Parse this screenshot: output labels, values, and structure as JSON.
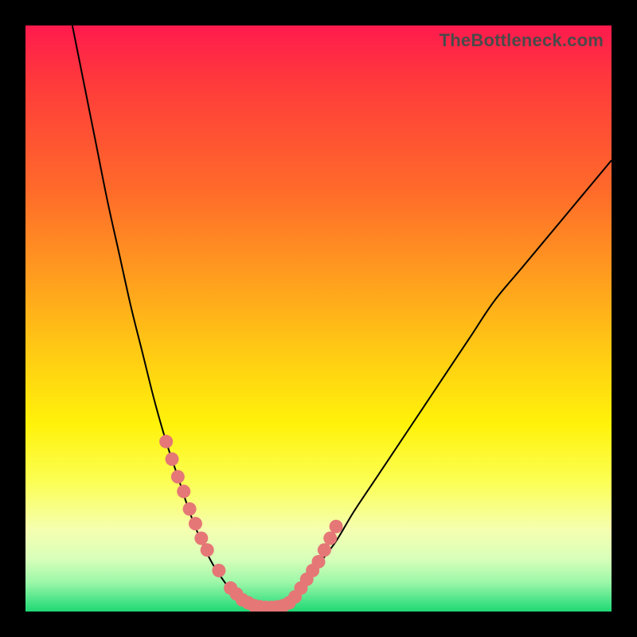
{
  "watermark": {
    "text": "TheBottleneck.com"
  },
  "chart_data": {
    "type": "line",
    "title": "",
    "xlabel": "",
    "ylabel": "",
    "xlim": [
      0,
      100
    ],
    "ylim": [
      0,
      100
    ],
    "grid": false,
    "legend": false,
    "series": [
      {
        "name": "curve-left",
        "x": [
          8,
          10,
          12,
          14,
          16,
          18,
          20,
          22,
          24,
          26,
          28,
          30,
          32,
          34,
          36,
          38
        ],
        "y": [
          100,
          90,
          80,
          70,
          61,
          52,
          44,
          36,
          29,
          23,
          17,
          12,
          8,
          5,
          2.5,
          1
        ]
      },
      {
        "name": "curve-right",
        "x": [
          44,
          46,
          48,
          50,
          53,
          56,
          60,
          64,
          68,
          72,
          76,
          80,
          85,
          90,
          95,
          100
        ],
        "y": [
          1,
          2.5,
          5,
          8,
          12,
          17,
          23,
          29,
          35,
          41,
          47,
          53,
          59,
          65,
          71,
          77
        ]
      },
      {
        "name": "flat-bottom",
        "x": [
          38,
          40,
          42,
          44
        ],
        "y": [
          1,
          0.5,
          0.5,
          1
        ]
      }
    ],
    "highlight_dots": {
      "name": "dots",
      "x": [
        24,
        25,
        26,
        27,
        28,
        29,
        30,
        31,
        33,
        35,
        36,
        37,
        38,
        39,
        40,
        41,
        42,
        43,
        44,
        45,
        46,
        47,
        48,
        49,
        50,
        51,
        52,
        53
      ],
      "y": [
        29,
        26,
        23,
        20.5,
        17.5,
        15,
        12.5,
        10.5,
        7,
        4,
        3,
        2,
        1.5,
        1,
        0.8,
        0.7,
        0.7,
        0.8,
        1,
        1.5,
        2.5,
        4,
        5.5,
        7,
        8.5,
        10.5,
        12.5,
        14.5
      ]
    },
    "colors": {
      "curve": "#000000",
      "dots": "#e57777"
    }
  }
}
